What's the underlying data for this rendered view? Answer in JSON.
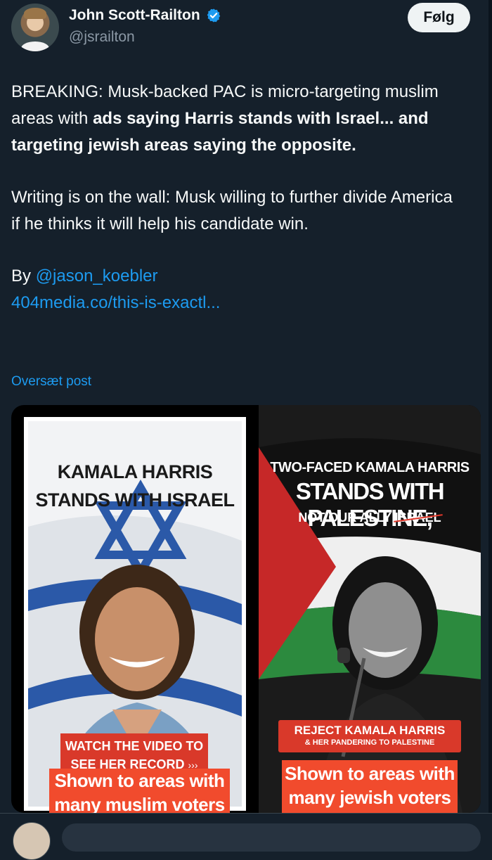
{
  "author": {
    "display_name": "John Scott-Railton",
    "handle": "@jsrailton",
    "verified": true
  },
  "follow_label": "Følg",
  "tweet": {
    "p1_plain": "BREAKING:  Musk-backed PAC is micro-targeting muslim areas with ",
    "p1_bold": "ads saying Harris stands with Israel... and targeting jewish areas saying the opposite.",
    "p2": "Writing is on the wall: Musk willing to further divide America if he thinks it will help his candidate win.",
    "by_label": "By ",
    "mention": "@jason_koebler",
    "link": "404media.co/this-is-exactl..."
  },
  "translate_label": "Oversæt post",
  "media": {
    "left_ad": {
      "headline_1": "KAMALA HARRIS",
      "headline_2": "STANDS WITH ISRAEL",
      "cta_1": "WATCH THE VIDEO TO",
      "cta_2": "SEE HER RECORD",
      "cta_arrows": "›››",
      "overlay_1": "Shown to areas with",
      "overlay_2": "many muslim voters"
    },
    "right_ad": {
      "headline_1": "TWO-FACED KAMALA HARRIS",
      "headline_2": "STANDS WITH PALESTINE,",
      "headline_3a": "NOT OUR ALLY ",
      "headline_3b": "ISRAEL",
      "cta_1": "REJECT KAMALA HARRIS",
      "cta_2": "& HER PANDERING TO PALESTINE",
      "overlay_1": "Shown to areas with",
      "overlay_2": "many jewish voters"
    }
  },
  "colors": {
    "background": "#15202b",
    "link": "#1d9bf0",
    "verified": "#1d9bf0",
    "overlay_red": "#f14b2d"
  }
}
